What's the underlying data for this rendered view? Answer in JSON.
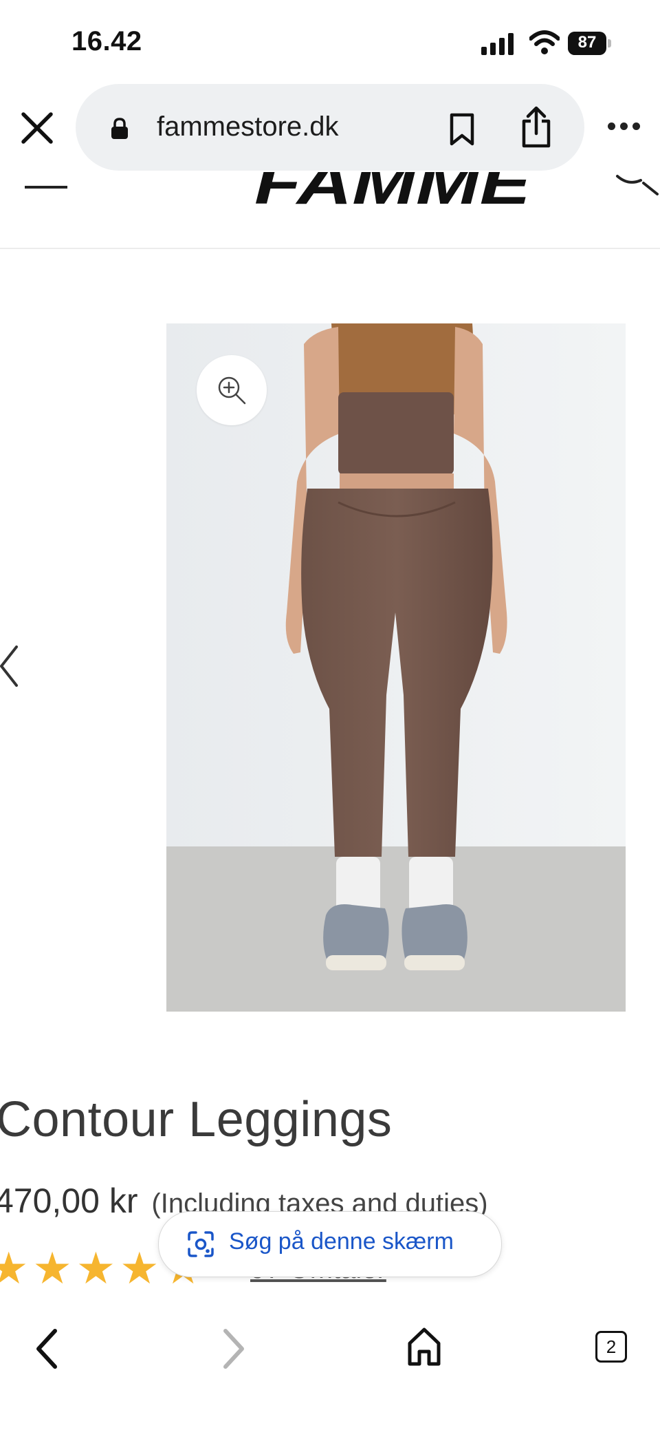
{
  "status_bar": {
    "time": "16.42",
    "battery_percent": "87",
    "battery_level": 0.87
  },
  "browser": {
    "url": "fammestore.dk",
    "icons": [
      "close-icon",
      "lock-icon",
      "bookmark-icon",
      "share-icon",
      "more-icon"
    ]
  },
  "site_header": {
    "logo_text": "FAMME",
    "icons": [
      "hamburger-icon",
      "search-icon"
    ]
  },
  "gallery": {
    "image_alt": "Brown Contour Leggings back view",
    "icons": [
      "chevron-left-icon",
      "zoom-in-icon"
    ]
  },
  "product": {
    "title": "Contour Leggings",
    "price": "470,00 kr",
    "price_note": "(Including taxes and duties)",
    "rating_stars": 5,
    "reviews_label": "97 Omtaler"
  },
  "lens": {
    "label": "Søg på denne skærm",
    "icon": "lens-icon"
  },
  "toolbar": {
    "tabs_count": "2",
    "icons": [
      "back-icon",
      "forward-icon",
      "home-icon",
      "tabs-icon"
    ]
  },
  "colors": {
    "star": "#f6b52f",
    "lens_text": "#1a56c8",
    "url_bar_bg": "#eef0f2"
  }
}
